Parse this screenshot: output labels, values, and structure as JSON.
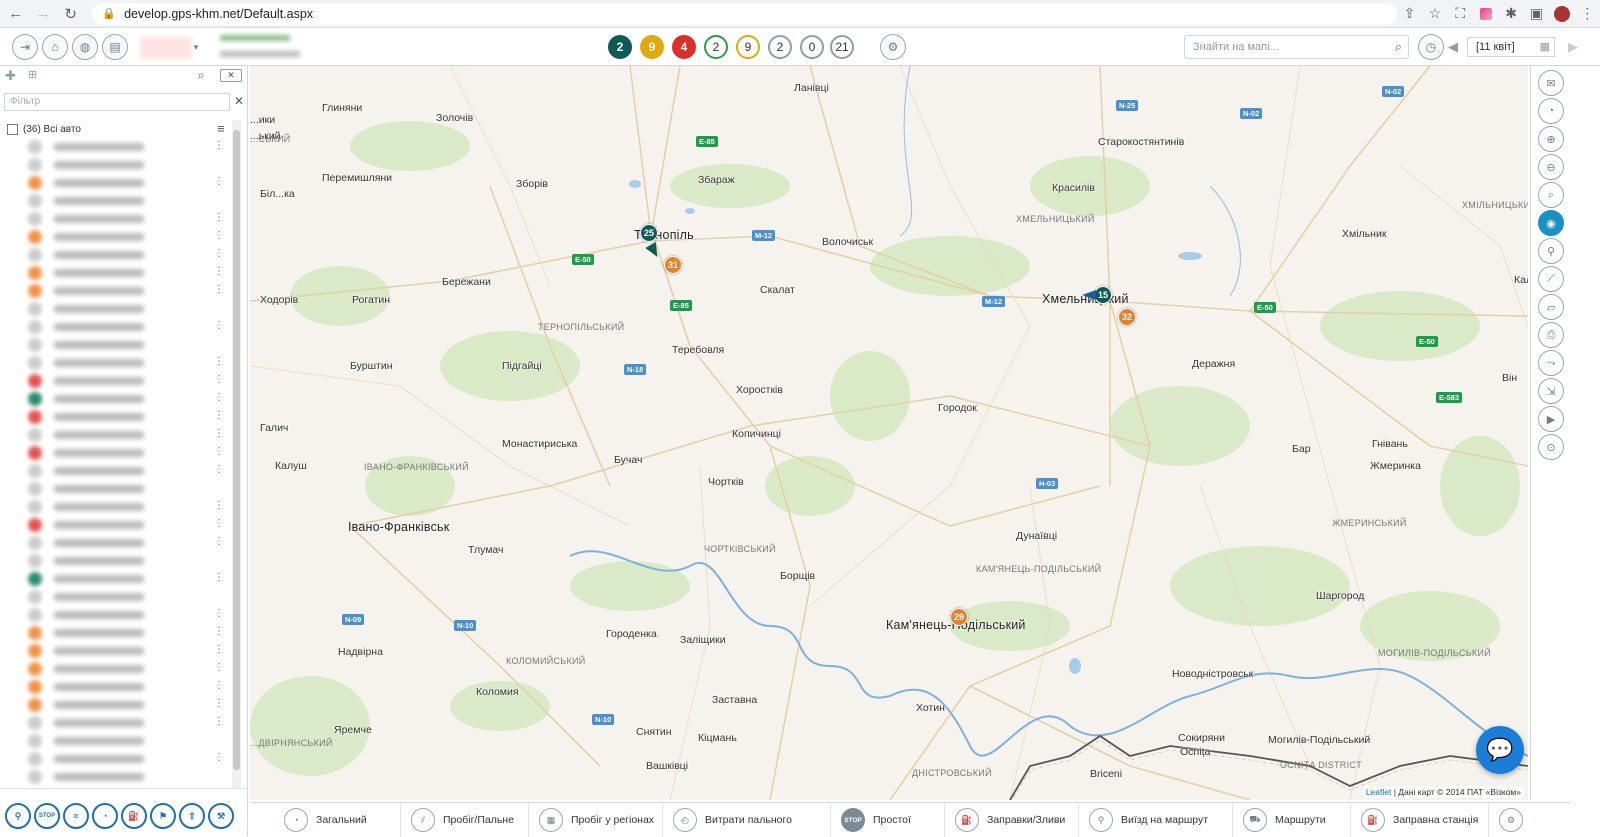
{
  "browser": {
    "url": "develop.gps-khm.net/Default.aspx"
  },
  "toolbar": {
    "badges": [
      {
        "value": "2",
        "color": "#0e5b55",
        "style": "solid"
      },
      {
        "value": "9",
        "color": "#e3a712",
        "style": "solid"
      },
      {
        "value": "4",
        "color": "#d9302c",
        "style": "solid"
      },
      {
        "value": "2",
        "color": "#2e9b4a",
        "style": "ring"
      },
      {
        "value": "9",
        "color": "#e3a712",
        "style": "ring"
      },
      {
        "value": "2",
        "color": "#8aa0b0",
        "style": "ring"
      },
      {
        "value": "0",
        "color": "#8aa0b0",
        "style": "ring"
      },
      {
        "value": "21",
        "color": "#8aa0b0",
        "style": "ring"
      }
    ],
    "search_placeholder": "Знайти на мапі...",
    "date": "[11 квіт]"
  },
  "left_panel": {
    "filter_placeholder": "Фільтр",
    "all_label": "(36) Всі авто",
    "vehicle_dot_colors": [
      "#ccc",
      "#ccc",
      "#f0954a",
      "#ccc",
      "#ccc",
      "#f0954a",
      "#ccc",
      "#f0954a",
      "#f0954a",
      "#ccc",
      "#ccc",
      "#ccc",
      "#ccc",
      "#e25555",
      "#2e8b70",
      "#e25555",
      "#ccc",
      "#e25555",
      "#ccc",
      "#ccc",
      "#ccc",
      "#e25555",
      "#ccc",
      "#ccc",
      "#2e8b70",
      "#ccc",
      "#ccc",
      "#f0954a",
      "#f0954a",
      "#f0954a",
      "#f0954a",
      "#f0954a",
      "#ccc",
      "#ccc",
      "#ccc",
      "#ccc"
    ]
  },
  "map": {
    "cities": [
      {
        "name": "Ланівці",
        "big": false
      },
      {
        "name": "Глиняни",
        "big": false
      },
      {
        "name": "Золочів",
        "big": false
      },
      {
        "name": "Збараж",
        "big": false
      },
      {
        "name": "Старокостянтинів",
        "big": false
      },
      {
        "name": "Перемишляни",
        "big": false
      },
      {
        "name": "Зборів",
        "big": false
      },
      {
        "name": "Красилів",
        "big": false
      },
      {
        "name": "Тернопіль",
        "big": true
      },
      {
        "name": "Волочиськ",
        "big": false
      },
      {
        "name": "Хмільник",
        "big": false
      },
      {
        "name": "Бережани",
        "big": false
      },
      {
        "name": "Скалат",
        "big": false
      },
      {
        "name": "Хмельницький",
        "big": true
      },
      {
        "name": "Ходорів",
        "big": false
      },
      {
        "name": "Рогатин",
        "big": false
      },
      {
        "name": "Теребовля",
        "big": false
      },
      {
        "name": "Деражня",
        "big": false
      },
      {
        "name": "Бурштин",
        "big": false
      },
      {
        "name": "Підгайці",
        "big": false
      },
      {
        "name": "Хоростків",
        "big": false
      },
      {
        "name": "Городок",
        "big": false
      },
      {
        "name": "Галич",
        "big": false
      },
      {
        "name": "Копичинці",
        "big": false
      },
      {
        "name": "Монастириська",
        "big": false
      },
      {
        "name": "Бучач",
        "big": false
      },
      {
        "name": "Бар",
        "big": false
      },
      {
        "name": "Гнівань",
        "big": false
      },
      {
        "name": "Калуш",
        "big": false
      },
      {
        "name": "Чортків",
        "big": false
      },
      {
        "name": "Жмеринка",
        "big": false
      },
      {
        "name": "Івано-Франківськ",
        "big": true
      },
      {
        "name": "Тлумач",
        "big": false
      },
      {
        "name": "Дунаївці",
        "big": false
      },
      {
        "name": "Борщів",
        "big": false
      },
      {
        "name": "Шаргород",
        "big": false
      },
      {
        "name": "Кам'янець-Подільський",
        "big": true
      },
      {
        "name": "Городенка",
        "big": false
      },
      {
        "name": "Заліщики",
        "big": false
      },
      {
        "name": "Надвірна",
        "big": false
      },
      {
        "name": "Новодністровськ",
        "big": false
      },
      {
        "name": "Коломия",
        "big": false
      },
      {
        "name": "Заставна",
        "big": false
      },
      {
        "name": "Хотин",
        "big": false
      },
      {
        "name": "Яремче",
        "big": false
      },
      {
        "name": "Снятин",
        "big": false
      },
      {
        "name": "Кіцмань",
        "big": false
      },
      {
        "name": "Сокиряни",
        "big": false
      },
      {
        "name": "Могилів-Подільський",
        "big": false
      },
      {
        "name": "Ocnița",
        "big": false
      },
      {
        "name": "Вашківці",
        "big": false
      },
      {
        "name": "Briceni",
        "big": false
      },
      {
        "name": "Біл...ка",
        "big": false
      },
      {
        "name": "Він",
        "big": false
      },
      {
        "name": "Кал",
        "big": false
      },
      {
        "name": "...ики",
        "big": false
      },
      {
        "name": "...ький",
        "big": false
      }
    ],
    "regions": [
      "ХМЕЛЬНИЦЬКИЙ",
      "ХМІЛЬНИЦЬКИЙ",
      "ТЕРНОПІЛЬСЬКИЙ",
      "ІВАНО-ФРАНКІВСЬКИЙ",
      "ЖМЕРИНСЬКИЙ",
      "ЧОРТКІВСЬКИЙ",
      "КАМ'ЯНЕЦЬ-ПОДІЛЬСЬКИЙ",
      "КОЛОМИЙСЬКИЙ",
      "МОГИЛІВ-ПОДІЛЬСЬКИЙ",
      "ДНІСТРОВСЬКИЙ",
      "...ДВІРНЯНСЬКИЙ",
      "OCNIȚA DISTRICT",
      "...СЬКИЙ"
    ],
    "roads": [
      {
        "label": "E-85",
        "type": "e"
      },
      {
        "label": "E-50",
        "type": "e"
      },
      {
        "label": "E-85",
        "type": "e"
      },
      {
        "label": "M-12",
        "type": "m"
      },
      {
        "label": "M-12",
        "type": "m"
      },
      {
        "label": "E-50",
        "type": "e"
      },
      {
        "label": "E-50",
        "type": "e"
      },
      {
        "label": "E-583",
        "type": "e"
      },
      {
        "label": "N-18",
        "type": "m"
      },
      {
        "label": "H-03",
        "type": "m"
      },
      {
        "label": "N-09",
        "type": "m"
      },
      {
        "label": "N-10",
        "type": "m"
      },
      {
        "label": "N-10",
        "type": "m"
      },
      {
        "label": "N-02",
        "type": "m"
      },
      {
        "label": "N-25",
        "type": "m"
      },
      {
        "label": "N-02",
        "type": "m"
      }
    ],
    "markers": [
      {
        "value": "25",
        "type": "teal"
      },
      {
        "value": "31",
        "type": "orange"
      },
      {
        "value": "15",
        "type": "teal"
      },
      {
        "value": "32",
        "type": "orange"
      },
      {
        "value": "29",
        "type": "orange"
      }
    ],
    "attribution_link": "Leaflet",
    "attribution_text": " | Дані карт © 2014 ПАТ «Візком»"
  },
  "bottom_tabs": [
    {
      "label": "Загальний",
      "icon": "gauge-icon"
    },
    {
      "label": "Пробіг/Пальне",
      "icon": "road-icon"
    },
    {
      "label": "Пробіг у регіонах",
      "icon": "map-region-icon"
    },
    {
      "label": "Витрати пального",
      "icon": "fuel-gauge-icon"
    },
    {
      "label": "Простої",
      "icon": "stop-icon"
    },
    {
      "label": "Заправки/Зливи",
      "icon": "fuel-pump-icon"
    },
    {
      "label": "Виїзд на маршрут",
      "icon": "route-start-icon"
    },
    {
      "label": "Маршрути",
      "icon": "truck-icon"
    },
    {
      "label": "Заправна станція",
      "icon": "gas-station-icon"
    }
  ]
}
